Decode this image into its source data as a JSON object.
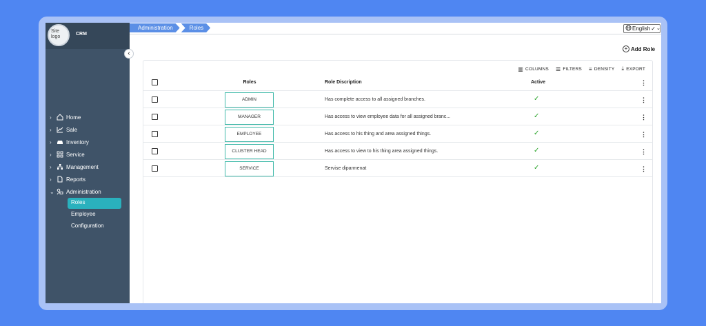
{
  "sidebar": {
    "logo_alt": "Site logo",
    "brand": "CRM",
    "collapse_icon": "chevron-left-icon",
    "items": [
      {
        "label": "Home",
        "icon": "home-icon",
        "expanded": false
      },
      {
        "label": "Sale",
        "icon": "chart-icon",
        "expanded": false
      },
      {
        "label": "Inventory",
        "icon": "car-icon",
        "expanded": false
      },
      {
        "label": "Service",
        "icon": "grid-icon",
        "expanded": false
      },
      {
        "label": "Management",
        "icon": "org-icon",
        "expanded": false
      },
      {
        "label": "Reports",
        "icon": "file-icon",
        "expanded": false
      },
      {
        "label": "Administration",
        "icon": "admin-icon",
        "expanded": true
      }
    ],
    "sub_items": [
      {
        "label": "Roles",
        "active": true
      },
      {
        "label": "Employee",
        "active": false
      },
      {
        "label": "Configuration",
        "active": false
      }
    ],
    "active_color": "#2ab1bd"
  },
  "breadcrumb": [
    "Administration",
    "Roles"
  ],
  "language": {
    "value": "English",
    "icon": "globe-icon"
  },
  "add_role_label": "Add Role",
  "toolbar": {
    "columns": "COLUMNS",
    "filters": "FILTERS",
    "density": "DENSITY",
    "export": "EXPORT"
  },
  "table": {
    "headers": {
      "roles": "Roles",
      "description": "Role Discription",
      "active": "Active"
    },
    "rows": [
      {
        "role": "ADMIN",
        "description": "Has complete access to all assigned branches.",
        "active": true
      },
      {
        "role": "MANAGER",
        "description": "Has access to view employee data for all assigned branc...",
        "active": true
      },
      {
        "role": "EMPLOYEE",
        "description": "Has access to his thing and area assigned things.",
        "active": true
      },
      {
        "role": "CLUSTER HEAD",
        "description": "Has access to view to his thing area assigned things.",
        "active": true
      },
      {
        "role": "SERVICE",
        "description": "Servise diparmenat",
        "active": true
      }
    ]
  },
  "colors": {
    "accent": "#5b8fe6",
    "check": "#2aa52a",
    "sidebar": "#3f5368"
  }
}
